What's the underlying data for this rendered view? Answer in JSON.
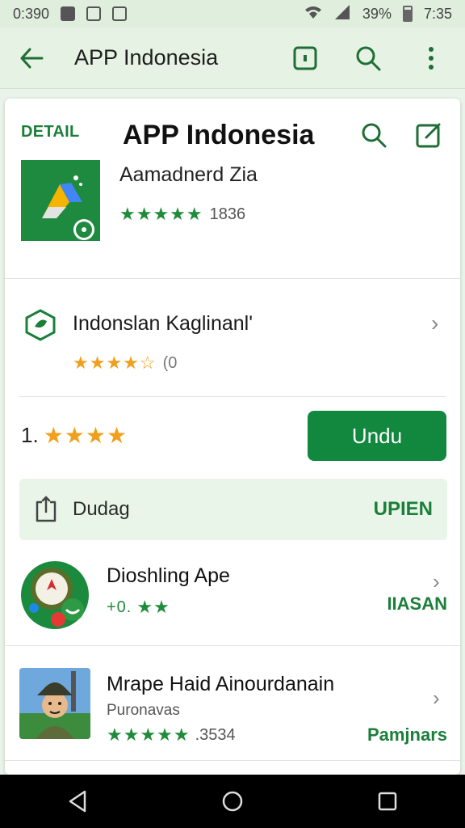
{
  "status_bar": {
    "time_left": "0:390",
    "battery": "39%",
    "time_right": "7:35"
  },
  "toolbar": {
    "title": "APP Indonesia"
  },
  "header": {
    "section_label": "DETAIL",
    "app_title": "APP Indonesia",
    "app_subtitle": "Aamadnerd Zia",
    "rating_stars": "★★★★★",
    "rating_count": "1836"
  },
  "developer": {
    "name": "Indonslan Kaglinanl'",
    "rating_stars": "★★★★☆",
    "rating_count": "(0"
  },
  "score": {
    "value": "1.",
    "stars": "★★★★"
  },
  "install_button": {
    "label": "Undu"
  },
  "promo": {
    "label": "Dudag",
    "action": "UPIEN"
  },
  "list": [
    {
      "title": "Dioshling Ape",
      "rating_prefix": "+0.",
      "stars": "★★",
      "action": "IIASAN"
    },
    {
      "title": "Mrape Haid Ainourdanain",
      "subtitle": "Puronavas",
      "stars": "★★★★★",
      "rating_count": ".3534",
      "action": "Pamjnars"
    }
  ],
  "colors": {
    "brand_green": "#12873e",
    "star_gold": "#f0a01d",
    "star_green": "#1f8c3a"
  }
}
